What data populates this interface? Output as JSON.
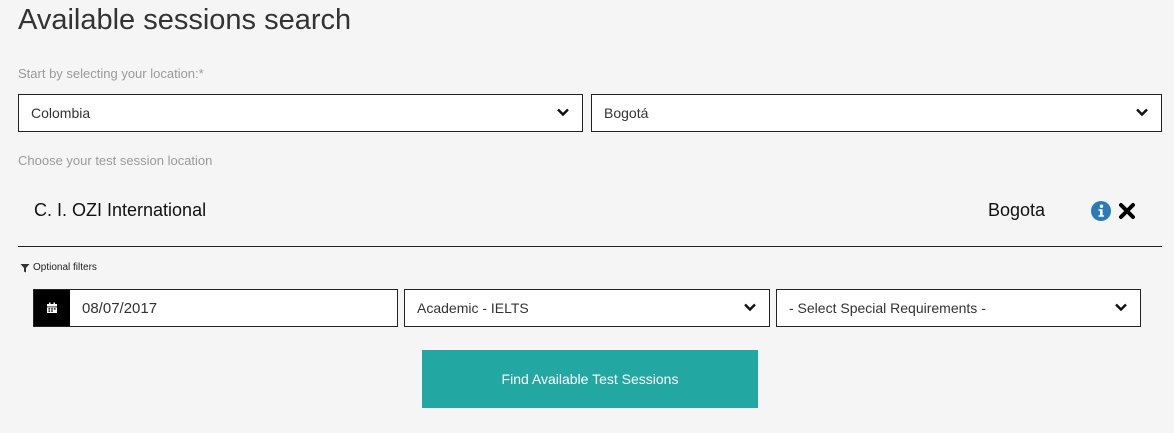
{
  "page": {
    "title": "Available sessions search",
    "location_prompt": "Start by selecting your location:*",
    "session_location_prompt": "Choose your test session location"
  },
  "location": {
    "country": "Colombia",
    "city": "Bogotá"
  },
  "selected_center": {
    "name": "C. I. OZI International",
    "city": "Bogota",
    "info_icon": "info-circle-icon",
    "remove_icon": "close-icon"
  },
  "filters": {
    "label": "Optional filters",
    "date": "08/07/2017",
    "test_type": "Academic - IELTS",
    "special_requirements": "- Select Special Requirements -"
  },
  "actions": {
    "find_label": "Find Available Test Sessions"
  },
  "colors": {
    "accent": "#22a7a2",
    "info": "#2b7bb9",
    "background": "#f5f5f5"
  }
}
